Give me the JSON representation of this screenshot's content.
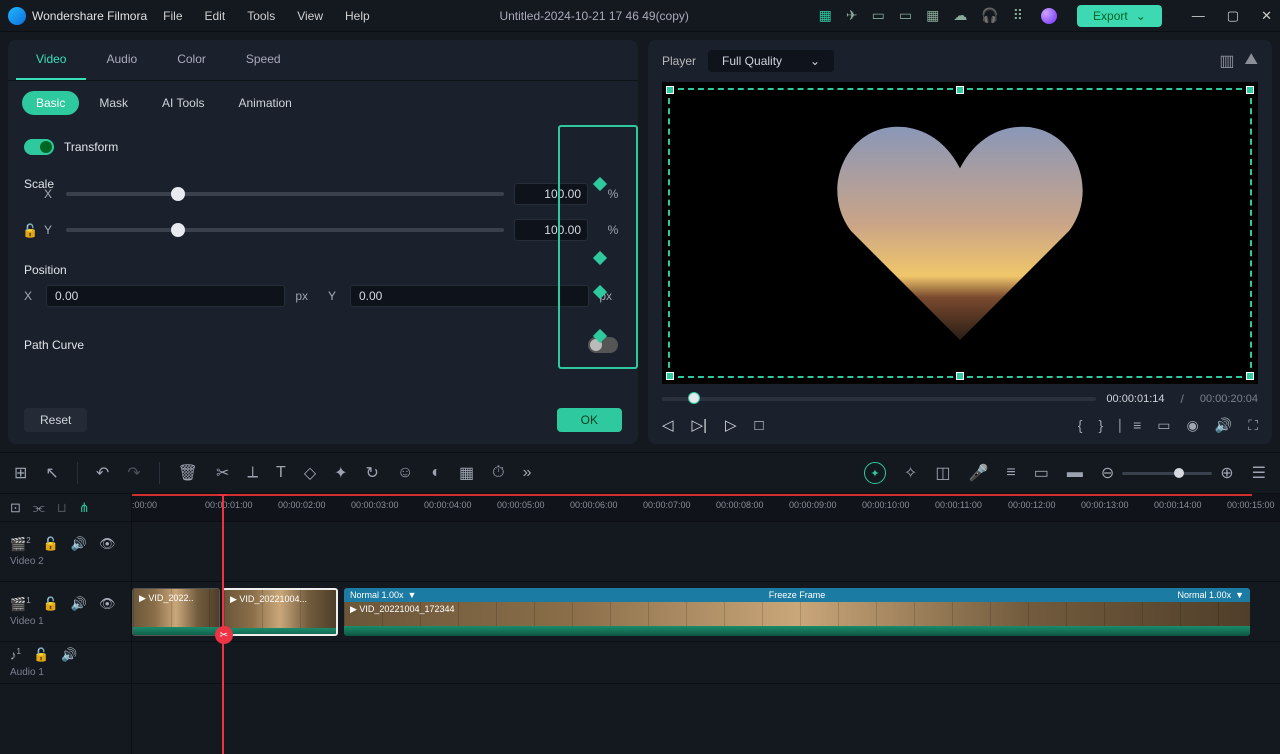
{
  "app": {
    "name": "Wondershare Filmora"
  },
  "menu": [
    "File",
    "Edit",
    "Tools",
    "View",
    "Help"
  ],
  "document": {
    "title": "Untitled-2024-10-21 17 46 49(copy)"
  },
  "export_label": "Export",
  "inspector": {
    "tabs": [
      "Video",
      "Audio",
      "Color",
      "Speed"
    ],
    "active_tab": "Video",
    "subtabs": [
      "Basic",
      "Mask",
      "AI Tools",
      "Animation"
    ],
    "active_subtab": "Basic",
    "transform_label": "Transform",
    "scale_label": "Scale",
    "x_label": "X",
    "y_label": "Y",
    "scale_x": "100.00",
    "scale_y": "100.00",
    "scale_unit": "%",
    "position_label": "Position",
    "pos_x": "0.00",
    "pos_y": "0.00",
    "pos_unit": "px",
    "path_curve_label": "Path Curve",
    "reset_label": "Reset",
    "ok_label": "OK"
  },
  "player": {
    "label": "Player",
    "quality": "Full Quality",
    "time_current": "00:00:01:14",
    "time_total": "00:00:20:04"
  },
  "timeline": {
    "ticks": [
      ":00:00",
      "00:00:01:00",
      "00:00:02:00",
      "00:00:03:00",
      "00:00:04:00",
      "00:00:05:00",
      "00:00:06:00",
      "00:00:07:00",
      "00:00:08:00",
      "00:00:09:00",
      "00:00:10:00",
      "00:00:11:00",
      "00:00:12:00",
      "00:00:13:00",
      "00:00:14:00",
      "00:00:15:00"
    ],
    "tracks": {
      "video2": {
        "badge": "2",
        "label": "Video 2"
      },
      "video1": {
        "badge": "1",
        "label": "Video 1"
      },
      "audio1": {
        "badge": "1",
        "label": "Audio 1"
      }
    },
    "clips": {
      "c1_name": "VID_2022..",
      "c2_name": "VID_20221004...",
      "c3_head_left": "Normal 1.00x",
      "c3_head_mid": "Freeze Frame",
      "c3_head_right": "Normal 1.00x",
      "c3_name": "VID_20221004_172344"
    }
  }
}
